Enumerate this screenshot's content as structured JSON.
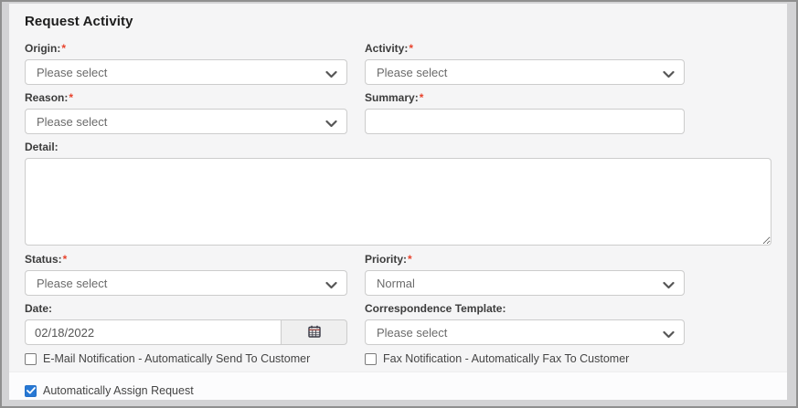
{
  "window": {
    "title": "Request Activity"
  },
  "ui": {
    "required_marker": "*",
    "accent_blue": "#2778d4",
    "required_red": "#e8432d"
  },
  "fields": {
    "origin": {
      "label": "Origin:",
      "required": true,
      "value": "Please select"
    },
    "activity": {
      "label": "Activity:",
      "required": true,
      "value": "Please select"
    },
    "reason": {
      "label": "Reason:",
      "required": true,
      "value": "Please select"
    },
    "summary": {
      "label": "Summary:",
      "required": true,
      "value": ""
    },
    "detail": {
      "label": "Detail:",
      "required": false,
      "value": ""
    },
    "status": {
      "label": "Status:",
      "required": true,
      "value": "Please select"
    },
    "priority": {
      "label": "Priority:",
      "required": true,
      "value": "Normal"
    },
    "date": {
      "label": "Date:",
      "required": false,
      "value": "02/18/2022"
    },
    "correspondence_template": {
      "label": "Correspondence Template:",
      "required": false,
      "value": "Please select"
    }
  },
  "checkboxes": {
    "email_notification": {
      "label": "E-Mail Notification - Automatically Send To Customer",
      "checked": false
    },
    "fax_notification": {
      "label": "Fax Notification - Automatically Fax To Customer",
      "checked": false
    },
    "auto_assign": {
      "label": "Automatically Assign Request",
      "checked": true
    }
  }
}
